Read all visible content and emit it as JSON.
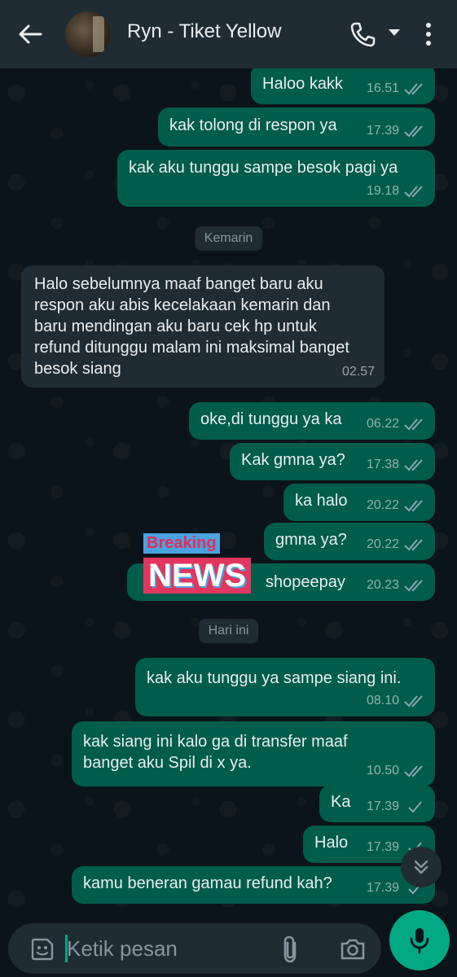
{
  "header": {
    "contact_name": "Ryn - Tiket Yellow",
    "icons": [
      "back-arrow-icon",
      "avatar",
      "phone-icon",
      "dropdown-caret-icon",
      "more-vertical-icon"
    ]
  },
  "day_separators": {
    "yesterday": "Kemarin",
    "today": "Hari ini"
  },
  "messages": [
    {
      "dir": "out",
      "text": "Haloo kakk",
      "time": "16.51",
      "status": "read"
    },
    {
      "dir": "out",
      "text": "kak tolong di respon ya",
      "time": "17.39",
      "status": "read"
    },
    {
      "dir": "out",
      "text": "kak aku tunggu sampe besok pagi ya",
      "time": "19.18",
      "status": "read"
    },
    {
      "dir": "in",
      "text": "Halo sebelumnya maaf banget baru aku respon aku abis kecelakaan kemarin dan baru mendingan aku baru cek hp untuk refund ditunggu malam ini maksimal banget besok siang",
      "time": "02.57"
    },
    {
      "dir": "out",
      "text": "oke,di tunggu ya ka",
      "time": "06.22",
      "status": "read"
    },
    {
      "dir": "out",
      "text": "Kak gmna ya?",
      "time": "17.38",
      "status": "read"
    },
    {
      "dir": "out",
      "text": "ka halo",
      "time": "20.22",
      "status": "read"
    },
    {
      "dir": "out",
      "text": "gmna ya?",
      "time": "20.22",
      "status": "read"
    },
    {
      "dir": "out",
      "text": "shopeepay",
      "time": "20.23",
      "status": "read"
    },
    {
      "dir": "out",
      "text": "kak aku tunggu ya sampe siang ini.",
      "time": "08.10",
      "status": "read"
    },
    {
      "dir": "out",
      "text": "kak siang ini kalo ga di transfer maaf banget aku Spil di x ya.",
      "time": "10.50",
      "status": "read"
    },
    {
      "dir": "out",
      "text": "Ka",
      "time": "17.39",
      "status": "sent"
    },
    {
      "dir": "out",
      "text": "Halo",
      "time": "17.39",
      "status": "sent"
    },
    {
      "dir": "out",
      "text": "kamu beneran gamau refund kah?",
      "time": "17.39",
      "status": "sent"
    }
  ],
  "overlay_sticker": {
    "line1": "Breaking",
    "line2": "NEWS"
  },
  "composer": {
    "placeholder": "Ketik pesan",
    "icons": [
      "emoji-icon",
      "attach-icon",
      "camera-icon",
      "mic-icon"
    ]
  },
  "colors": {
    "header_bg": "#1f2c33",
    "chat_bg": "#0b141a",
    "outgoing_bubble": "#005c4b",
    "incoming_bubble": "#202c33",
    "accent": "#00a884"
  }
}
